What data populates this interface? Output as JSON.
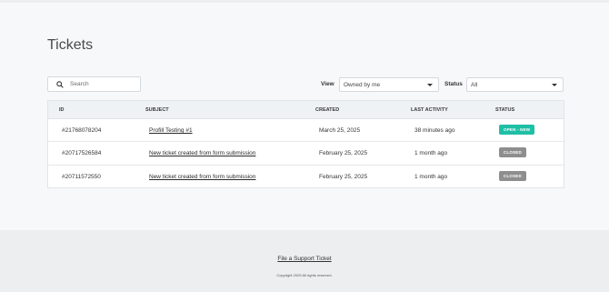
{
  "page": {
    "title": "Tickets"
  },
  "search": {
    "placeholder": "Search"
  },
  "filters": {
    "view_label": "View",
    "view_value": "Owned by me",
    "status_label": "Status",
    "status_value": "All"
  },
  "table": {
    "headers": [
      "ID",
      "SUBJECT",
      "CREATED",
      "LAST ACTIVITY",
      "STATUS"
    ],
    "rows": [
      {
        "id": "#21768078204",
        "subject": "Profill Testing #1",
        "created": "March 25, 2025",
        "activity": "38 minutes ago",
        "status": "OPEN - NEW",
        "status_color": "#1fbfa6"
      },
      {
        "id": "#20717526584",
        "subject": "New ticket created from form submission",
        "created": "February 25, 2025",
        "activity": "1 month ago",
        "status": "CLOSED",
        "status_color": "#8e8e8e"
      },
      {
        "id": "#20711572550",
        "subject": "New ticket created from form submission",
        "created": "February 25, 2025",
        "activity": "1 month ago",
        "status": "CLOSED",
        "status_color": "#8e8e8e"
      }
    ]
  },
  "footer": {
    "link": "File a Support Ticket",
    "copyright": "Copyright 2025 All rights reserved."
  }
}
